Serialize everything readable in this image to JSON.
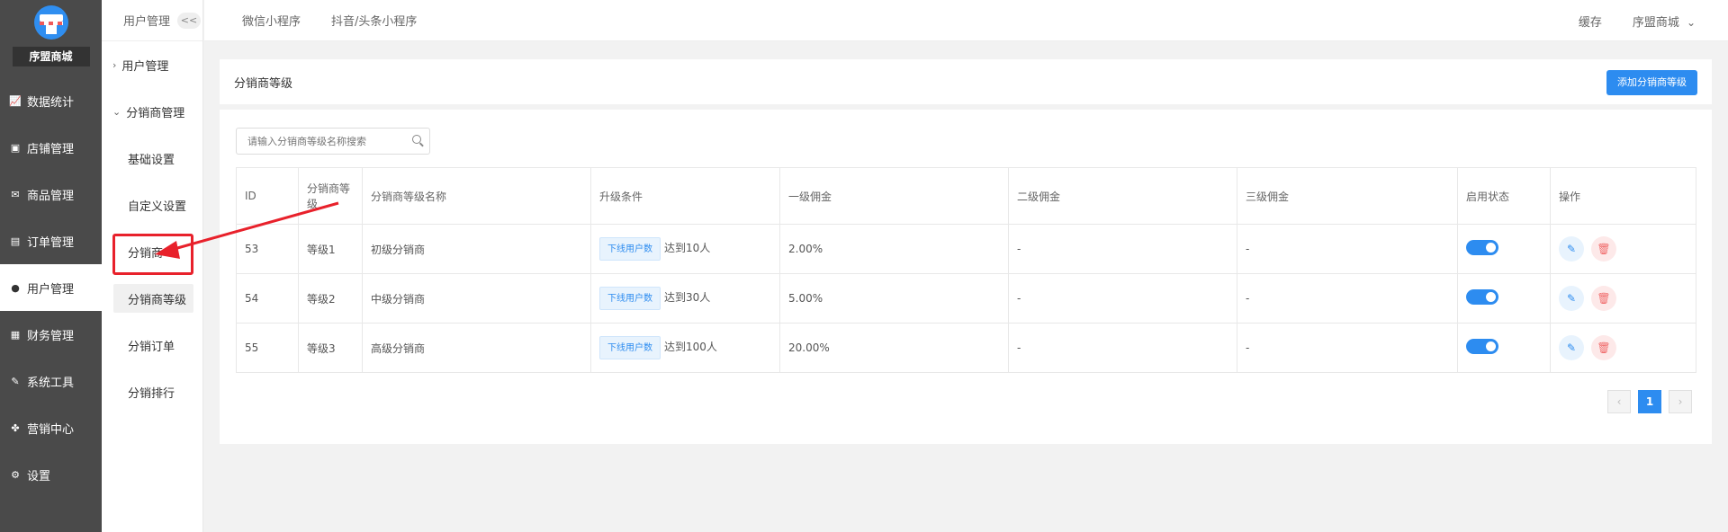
{
  "sidebar": {
    "shop_name": "序盟商城",
    "items": [
      {
        "label": "数据统计",
        "icon": "chart-icon"
      },
      {
        "label": "店铺管理",
        "icon": "shop-icon"
      },
      {
        "label": "商品管理",
        "icon": "product-icon"
      },
      {
        "label": "订单管理",
        "icon": "order-icon"
      },
      {
        "label": "用户管理",
        "icon": "user-icon",
        "active": true
      },
      {
        "label": "财务管理",
        "icon": "finance-icon"
      },
      {
        "label": "系统工具",
        "icon": "wrench-icon"
      },
      {
        "label": "营销中心",
        "icon": "marketing-icon"
      },
      {
        "label": "设置",
        "icon": "gear-icon"
      }
    ]
  },
  "submenu": {
    "header": "用户管理",
    "collapse": "<<",
    "groups": [
      {
        "label": "用户管理",
        "chevron": "›"
      },
      {
        "label": "分销商管理",
        "chevron": "⌄"
      }
    ],
    "items": [
      "基础设置",
      "自定义设置",
      "分销商",
      "分销商等级",
      "分销订单",
      "分销排行"
    ],
    "active": "分销商等级"
  },
  "topbar": {
    "tabs": [
      "微信小程序",
      "抖音/头条小程序"
    ],
    "cache": "缓存",
    "user": "序盟商城"
  },
  "page": {
    "title": "分销商等级",
    "add_button": "添加分销商等级",
    "search_placeholder": "请输入分销商等级名称搜索"
  },
  "table": {
    "headers": [
      "ID",
      "分销商等级",
      "分销商等级名称",
      "升级条件",
      "一级佣金",
      "二级佣金",
      "三级佣金",
      "启用状态",
      "操作"
    ],
    "rows": [
      {
        "id": "53",
        "level": "等级1",
        "name": "初级分销商",
        "cond_tag": "下线用户数",
        "cond_text": "达到10人",
        "c1": "2.00%",
        "c2": "-",
        "c3": "-"
      },
      {
        "id": "54",
        "level": "等级2",
        "name": "中级分销商",
        "cond_tag": "下线用户数",
        "cond_text": "达到30人",
        "c1": "5.00%",
        "c2": "-",
        "c3": "-"
      },
      {
        "id": "55",
        "level": "等级3",
        "name": "高级分销商",
        "cond_tag": "下线用户数",
        "cond_text": "达到100人",
        "c1": "20.00%",
        "c2": "-",
        "c3": "-"
      }
    ]
  },
  "pager": {
    "prev": "‹",
    "current": "1",
    "next": "›"
  },
  "colors": {
    "accent": "#2d8cf0",
    "sidebar_bg": "#4a4a4a",
    "annotation": "#e8212b"
  }
}
